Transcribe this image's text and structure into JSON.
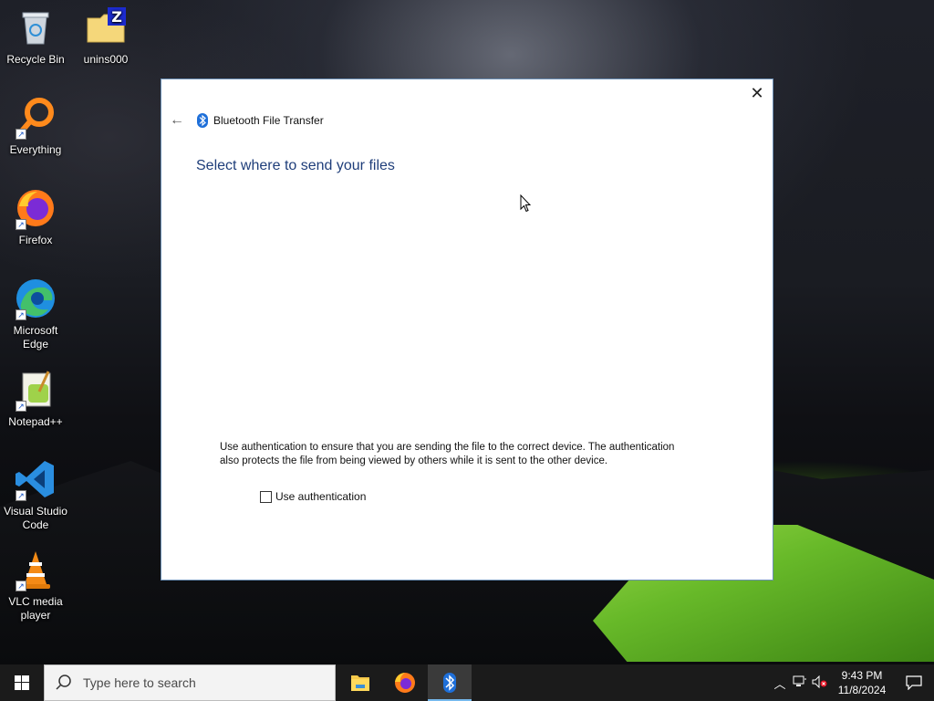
{
  "desktop": {
    "icons": [
      {
        "label": "Recycle Bin"
      },
      {
        "label": "unins000"
      },
      {
        "label": "Everything"
      },
      {
        "label": "Firefox"
      },
      {
        "label": "Microsoft Edge"
      },
      {
        "label": "Notepad++"
      },
      {
        "label": "Visual Studio Code"
      },
      {
        "label": "VLC media player"
      }
    ]
  },
  "dialog": {
    "title": "Bluetooth File Transfer",
    "heading": "Select where to send your files",
    "auth_description": "Use authentication to ensure that you are sending the file to the correct device. The authentication also protects the file from being viewed by others while it is sent to the other device.",
    "auth_checkbox_label": "Use authentication",
    "auth_checked": false,
    "close_glyph": "✕",
    "back_glyph": "←"
  },
  "taskbar": {
    "search_placeholder": "Type here to search",
    "clock_time": "9:43 PM",
    "clock_date": "11/8/2024",
    "apps": [
      "file-explorer",
      "firefox",
      "bluetooth"
    ]
  },
  "colors": {
    "heading": "#1f3e7a",
    "bluetooth": "#1e6fd9",
    "taskbar": "#1b1b1b",
    "active_indicator": "#76b9ed"
  }
}
